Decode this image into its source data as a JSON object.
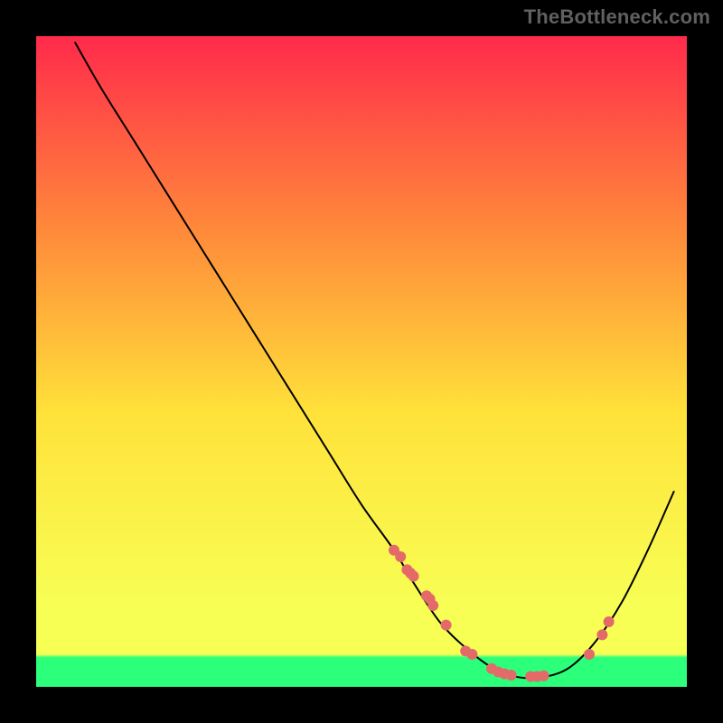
{
  "watermark": "TheBottleneck.com",
  "chart_data": {
    "type": "line",
    "title": "",
    "xlabel": "",
    "ylabel": "",
    "xlim": [
      0,
      100
    ],
    "ylim": [
      0,
      100
    ],
    "gradient_colors": {
      "top": "#ff2a4b",
      "upper_mid": "#ff8a3a",
      "mid": "#ffe23a",
      "lower": "#f7ff55",
      "bottom_band": "#2cff7a"
    },
    "series": [
      {
        "name": "curve",
        "color": "#000000",
        "x": [
          6,
          10,
          15,
          20,
          25,
          30,
          35,
          40,
          45,
          50,
          55,
          58,
          62,
          66,
          70,
          74,
          78,
          82,
          86,
          90,
          94,
          98
        ],
        "y": [
          99,
          92,
          84,
          76,
          68,
          60,
          52,
          44,
          36,
          28,
          21,
          16,
          10,
          6,
          3,
          1.5,
          1.5,
          3,
          7,
          13,
          21,
          30
        ]
      }
    ],
    "scatter": {
      "name": "points",
      "color": "#e46a6a",
      "radius": 6,
      "x": [
        55,
        56,
        57,
        57.5,
        58,
        60,
        60.5,
        61,
        63,
        66,
        67,
        70,
        71,
        72,
        73,
        76,
        77,
        78,
        85,
        87,
        88
      ],
      "y": [
        21,
        20,
        18,
        17.5,
        17,
        14,
        13.5,
        12.5,
        9.5,
        5.5,
        5,
        2.8,
        2.3,
        2,
        1.8,
        1.6,
        1.6,
        1.7,
        5,
        8,
        10
      ]
    }
  }
}
